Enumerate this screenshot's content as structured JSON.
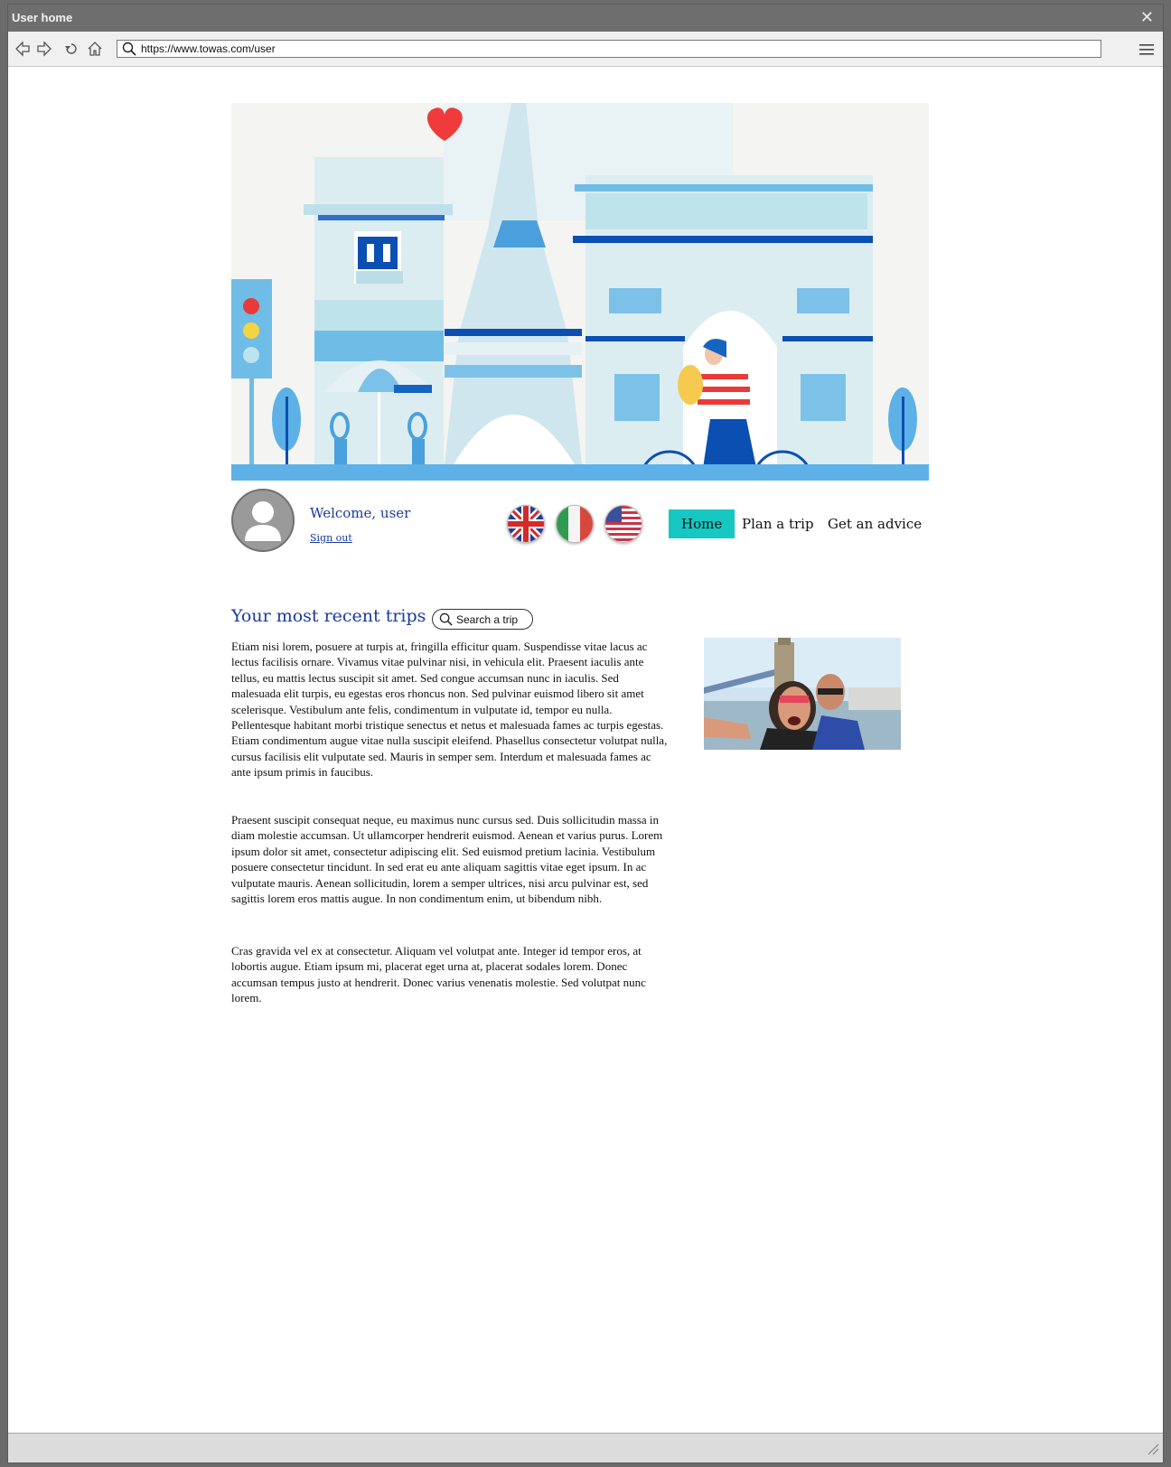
{
  "window": {
    "title": "User home"
  },
  "browser": {
    "url": "https://www.towas.com/user"
  },
  "profile": {
    "welcome": "Welcome, user",
    "signout": "Sign out"
  },
  "languages": [
    "English (UK)",
    "Italian",
    "English (US)"
  ],
  "nav": {
    "home": "Home",
    "plan": "Plan a trip",
    "advice": "Get an advice",
    "active_color": "#16c7c2"
  },
  "trips": {
    "title": "Your most recent trips",
    "search_label": "Search a trip",
    "paragraphs": [
      "Etiam nisi lorem, posuere at turpis at, fringilla efficitur quam. Suspendisse vitae lacus ac lectus facilisis ornare. Vivamus vitae pulvinar nisi, in vehicula elit. Praesent iaculis ante tellus, eu mattis lectus suscipit sit amet. Sed congue accumsan nunc in iaculis. Sed malesuada elit turpis, eu egestas eros rhoncus non. Sed pulvinar euismod libero sit amet scelerisque. Vestibulum ante felis, condimentum in vulputate id, tempor eu nulla. Pellentesque habitant morbi tristique senectus et netus et malesuada fames ac turpis egestas. Etiam condimentum augue vitae nulla suscipit eleifend. Phasellus consectetur volutpat nulla, cursus facilisis elit vulputate sed. Mauris in semper sem. Interdum et malesuada fames ac ante ipsum primis in faucibus.",
      "Praesent suscipit consequat neque, eu maximus nunc cursus sed. Duis sollicitudin massa in diam molestie accumsan. Ut ullamcorper hendrerit euismod. Aenean et varius purus. Lorem ipsum dolor sit amet, consectetur adipiscing elit. Sed euismod pretium lacinia. Vestibulum posuere consectetur tincidunt. In sed erat eu ante aliquam sagittis vitae eget ipsum. In ac vulputate mauris. Aenean sollicitudin, lorem a semper ultrices, nisi arcu pulvinar est, sed sagittis lorem eros mattis augue. In non condimentum enim, ut bibendum nibh.",
      "Cras gravida vel ex at consectetur. Aliquam vel volutpat ante. Integer id tempor eros, at lobortis augue. Etiam ipsum mi, placerat eget urna at, placerat sodales lorem. Donec accumsan tempus justo at hendrerit. Donec varius venenatis molestie. Sed volutpat nunc lorem."
    ]
  },
  "icons": {
    "back": "back-arrow-icon",
    "forward": "forward-arrow-icon",
    "reload": "reload-icon",
    "home": "home-icon",
    "search": "search-icon",
    "menu": "hamburger-menu-icon",
    "close": "close-icon"
  }
}
